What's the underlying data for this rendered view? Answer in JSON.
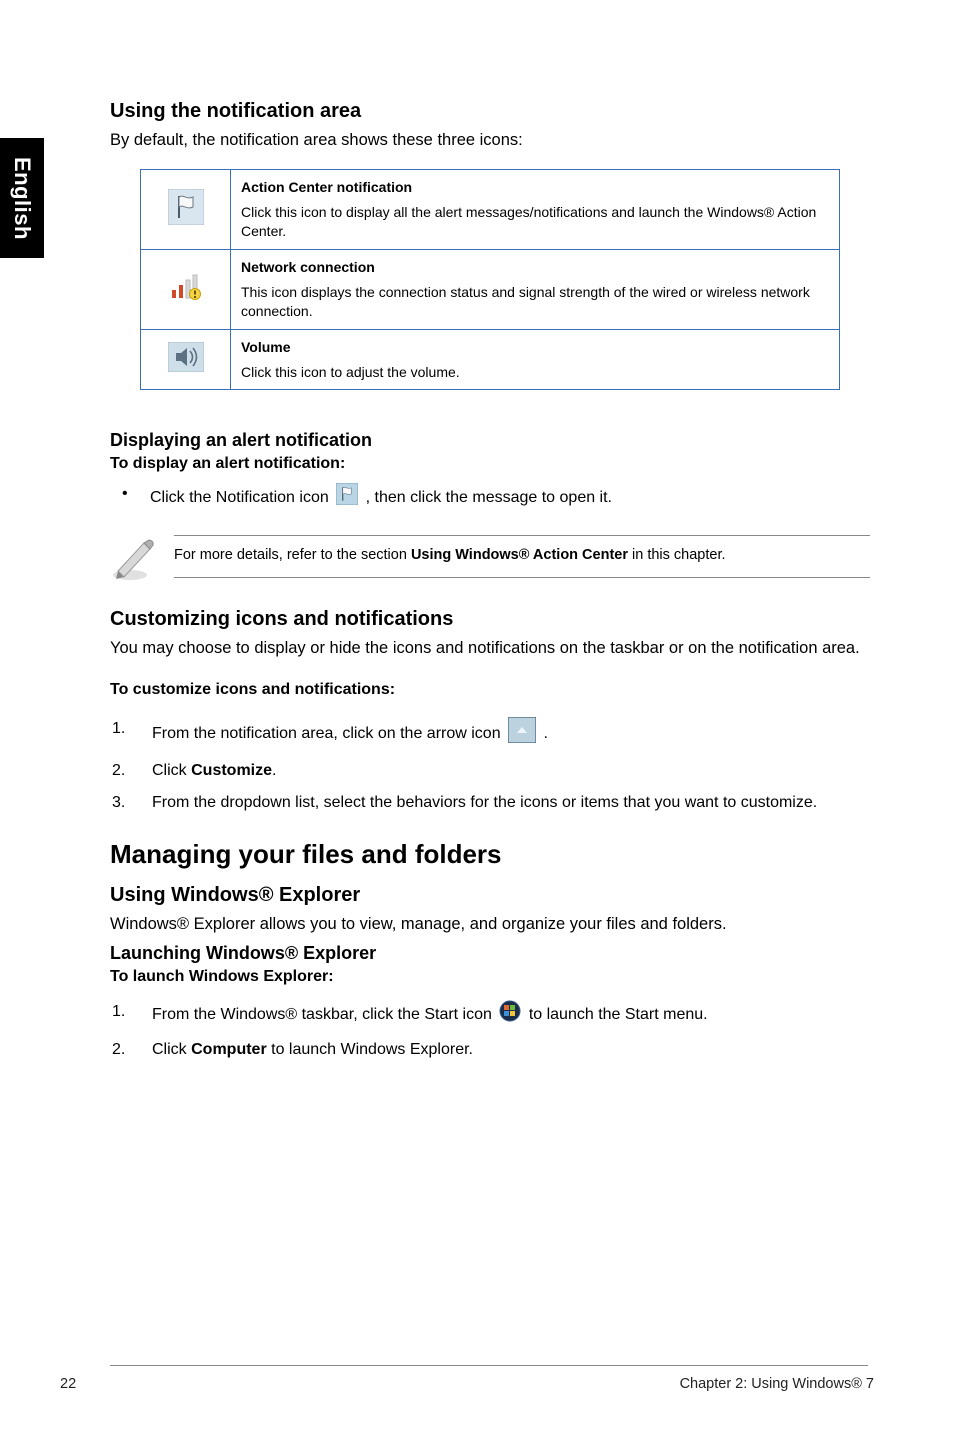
{
  "sidebar": {
    "label": "English"
  },
  "section1": {
    "heading": "Using the notification area",
    "lead": "By default, the notification area shows these three icons:"
  },
  "table": {
    "rows": [
      {
        "icon": "action-center-flag-icon",
        "title": "Action Center notification",
        "desc": "Click this icon to display all the alert messages/notifications and launch the Windows® Action Center."
      },
      {
        "icon": "network-connection-icon",
        "title": "Network connection",
        "desc": "This icon displays the connection status and signal strength of the wired or wireless network connection."
      },
      {
        "icon": "volume-icon",
        "title": "Volume",
        "desc": "Click this icon to adjust the volume."
      }
    ]
  },
  "alert": {
    "heading": "Displaying an alert notification",
    "subhead": "To display an alert notification:",
    "bullet_pre": "Click the Notification icon ",
    "bullet_post": ", then click the message to open it."
  },
  "note": {
    "pre": "For more details, refer to the section ",
    "bold": "Using Windows® Action Center",
    "post": " in this chapter."
  },
  "customize": {
    "heading": "Customizing icons and notifications",
    "lead": "You may choose to display or hide the icons and notifications on the taskbar or on the notification area.",
    "subhead": "To customize icons and notifications:",
    "step1_pre": "From the notification area, click on the arrow icon ",
    "step1_post": ".",
    "step2_pre": "Click ",
    "step2_bold": "Customize",
    "step2_post": ".",
    "step3": "From the dropdown list, select the behaviors for the icons or items that you want to customize."
  },
  "manage": {
    "heading": "Managing your files and folders",
    "sub1": "Using Windows® Explorer",
    "lead": "Windows® Explorer allows you to view, manage, and organize your files and folders.",
    "sub2": "Launching Windows® Explorer",
    "sub3": "To launch Windows Explorer:",
    "step1_pre": "From the Windows® taskbar, click the Start icon ",
    "step1_post": " to launch the Start menu.",
    "step2_pre": "Click ",
    "step2_bold": "Computer",
    "step2_post": " to launch Windows Explorer."
  },
  "footer": {
    "page": "22",
    "chapter": "Chapter 2: Using Windows® 7"
  },
  "numbers": {
    "n1": "1.",
    "n2": "2.",
    "n3": "3."
  }
}
